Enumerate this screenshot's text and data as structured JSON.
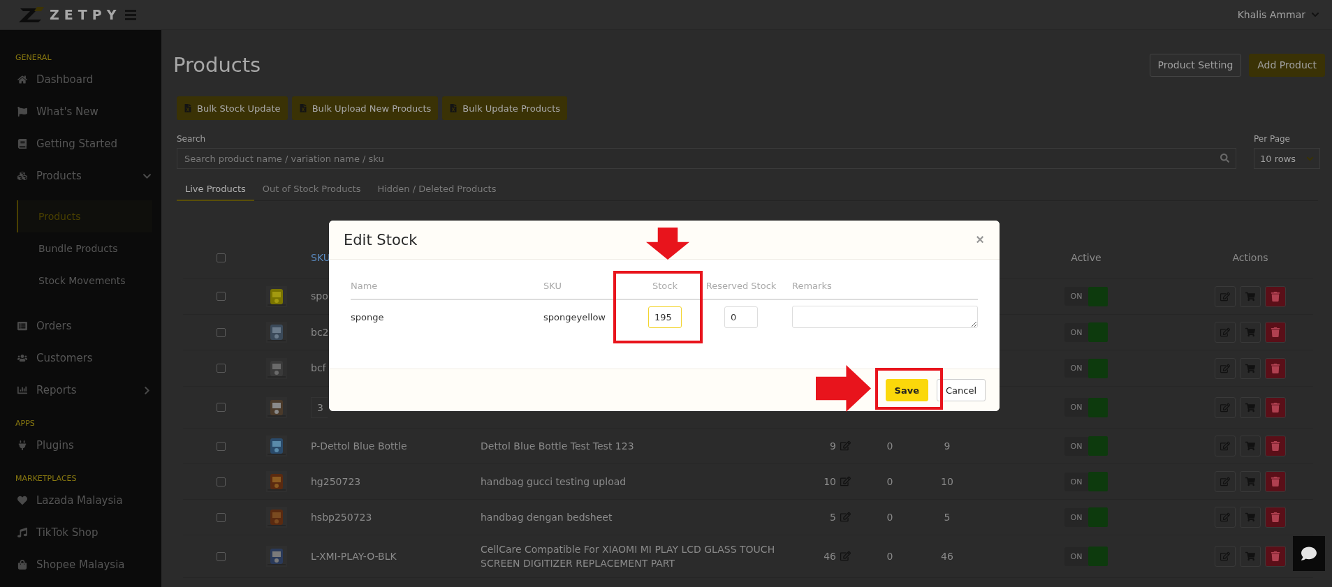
{
  "header": {
    "logo": "ZETPY",
    "user": "Khalis Ammar"
  },
  "sidebar": [
    {
      "title": "GENERAL",
      "items": [
        {
          "label": "Dashboard",
          "selected": false
        },
        {
          "label": "What's New",
          "selected": false
        },
        {
          "label": "Getting Started",
          "selected": false
        },
        {
          "label": "Products",
          "selected": false,
          "expanded": true,
          "children": [
            {
              "label": "Products",
              "selected": true
            },
            {
              "label": "Bundle Products",
              "selected": false
            },
            {
              "label": "Stock Movements",
              "selected": false
            }
          ]
        },
        {
          "label": "Orders",
          "selected": false
        },
        {
          "label": "Customers",
          "selected": false
        },
        {
          "label": "Reports",
          "selected": false,
          "expanded": false
        }
      ]
    },
    {
      "title": "APPS",
      "items": [
        {
          "label": "Plugins",
          "selected": false
        }
      ]
    },
    {
      "title": "MARKETPLACES",
      "items": [
        {
          "label": "Lazada Malaysia",
          "selected": false
        },
        {
          "label": "TikTok Shop",
          "selected": false
        },
        {
          "label": "Shopee Malaysia",
          "selected": false
        }
      ]
    }
  ],
  "page": {
    "title": "Products",
    "actions": [
      {
        "label": "Product Setting",
        "kind": "outline"
      },
      {
        "label": "Add Product",
        "kind": "primary"
      }
    ],
    "bulk_buttons": [
      "Bulk Stock Update",
      "Bulk Upload New Products",
      "Bulk Update Products"
    ],
    "search": {
      "label": "Search",
      "placeholder": "Search product name / variation name / sku"
    },
    "per_page": {
      "label": "Per Page",
      "value": "10 rows"
    },
    "tabs": [
      {
        "label": "Live Products",
        "selected": true
      },
      {
        "label": "Out of Stock Products",
        "selected": false
      },
      {
        "label": "Hidden / Deleted Products",
        "selected": false
      }
    ],
    "table": {
      "columns": {
        "sku": "SKU",
        "active": "Active",
        "actions": "Actions"
      },
      "select_all": {
        "checked": false
      },
      "rows": [
        {
          "checked": false,
          "sku": "spo",
          "active": true,
          "active_label": "ON"
        },
        {
          "checked": false,
          "sku": "bc2",
          "active": true,
          "active_label": "ON"
        },
        {
          "checked": false,
          "sku": "bcf",
          "active": true,
          "active_label": "ON"
        },
        {
          "checked": false,
          "variants": "3",
          "active": true,
          "active_label": "ON"
        },
        {
          "checked": false,
          "sku": "P-Dettol Blue Bottle",
          "name": "Dettol Blue Bottle Test Test 123",
          "stock": "9",
          "reserved": "0",
          "available": "9",
          "active": true,
          "active_label": "ON"
        },
        {
          "checked": false,
          "sku": "hg250723",
          "name": "handbag gucci testing upload",
          "stock": "10",
          "reserved": "0",
          "available": "10",
          "active": true,
          "active_label": "ON"
        },
        {
          "checked": false,
          "sku": "hsbp250723",
          "name": "handbag dengan bedsheet",
          "stock": "5",
          "reserved": "0",
          "available": "5",
          "active": true,
          "active_label": "ON"
        },
        {
          "checked": false,
          "sku": "L-XMI-PLAY-O-BLK",
          "name": "CellCare Compatible For XIAOMI MI PLAY LCD GLASS TOUCH SCREEN DIGITIZER REPLACEMENT PART",
          "stock": "46",
          "reserved": "0",
          "available": "46",
          "active": true,
          "active_label": "ON"
        }
      ]
    }
  },
  "modal": {
    "title": "Edit Stock",
    "close": "×",
    "columns": [
      "Name",
      "SKU",
      "Stock",
      "Reserved Stock",
      "Remarks"
    ],
    "row": {
      "name": "sponge",
      "sku": "spongeyellow",
      "stock": "195",
      "stock_focused": true,
      "reserved": "0"
    },
    "buttons": [
      {
        "label": "Save",
        "kind": "primary"
      },
      {
        "label": "Cancel",
        "kind": "secondary"
      }
    ]
  },
  "annotations": [
    {
      "kind": "arrow"
    },
    {
      "kind": "frame"
    },
    {
      "kind": "arrow"
    },
    {
      "kind": "frame"
    }
  ]
}
